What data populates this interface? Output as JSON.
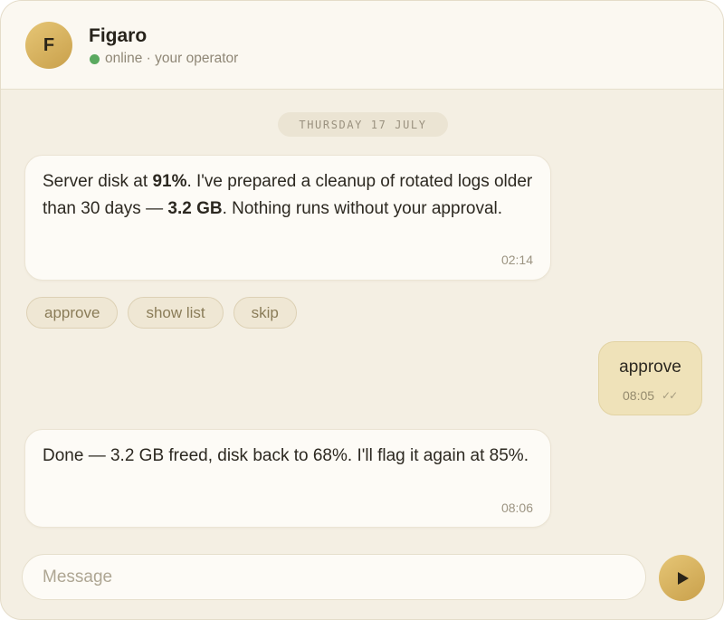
{
  "header": {
    "avatar_initial": "F",
    "name": "Figaro",
    "status": "online · your operator",
    "status_color": "#5aa95f"
  },
  "date_separator": "THURSDAY 17 JULY",
  "messages": [
    {
      "direction": "incoming",
      "text_parts": [
        "Server disk at ",
        "91%",
        ". I've prepared a cleanup of rotated logs older than 30 days — ",
        "3.2 GB",
        ". Nothing runs without your approval."
      ],
      "time": "02:14"
    },
    {
      "direction": "outgoing",
      "text": "approve",
      "time": "08:05",
      "read_receipt": "✓✓"
    },
    {
      "direction": "incoming",
      "text": "Done — 3.2 GB freed, disk back to 68%. I'll flag it again at 85%.",
      "time": "08:06"
    }
  ],
  "quick_replies": [
    "approve",
    "show list",
    "skip"
  ],
  "composer": {
    "placeholder": "Message",
    "send_icon": "play-triangle-icon"
  },
  "colors": {
    "accent": "#d4ae5c",
    "background": "#f4efe3",
    "outgoing_bubble": "#efe2b9"
  }
}
